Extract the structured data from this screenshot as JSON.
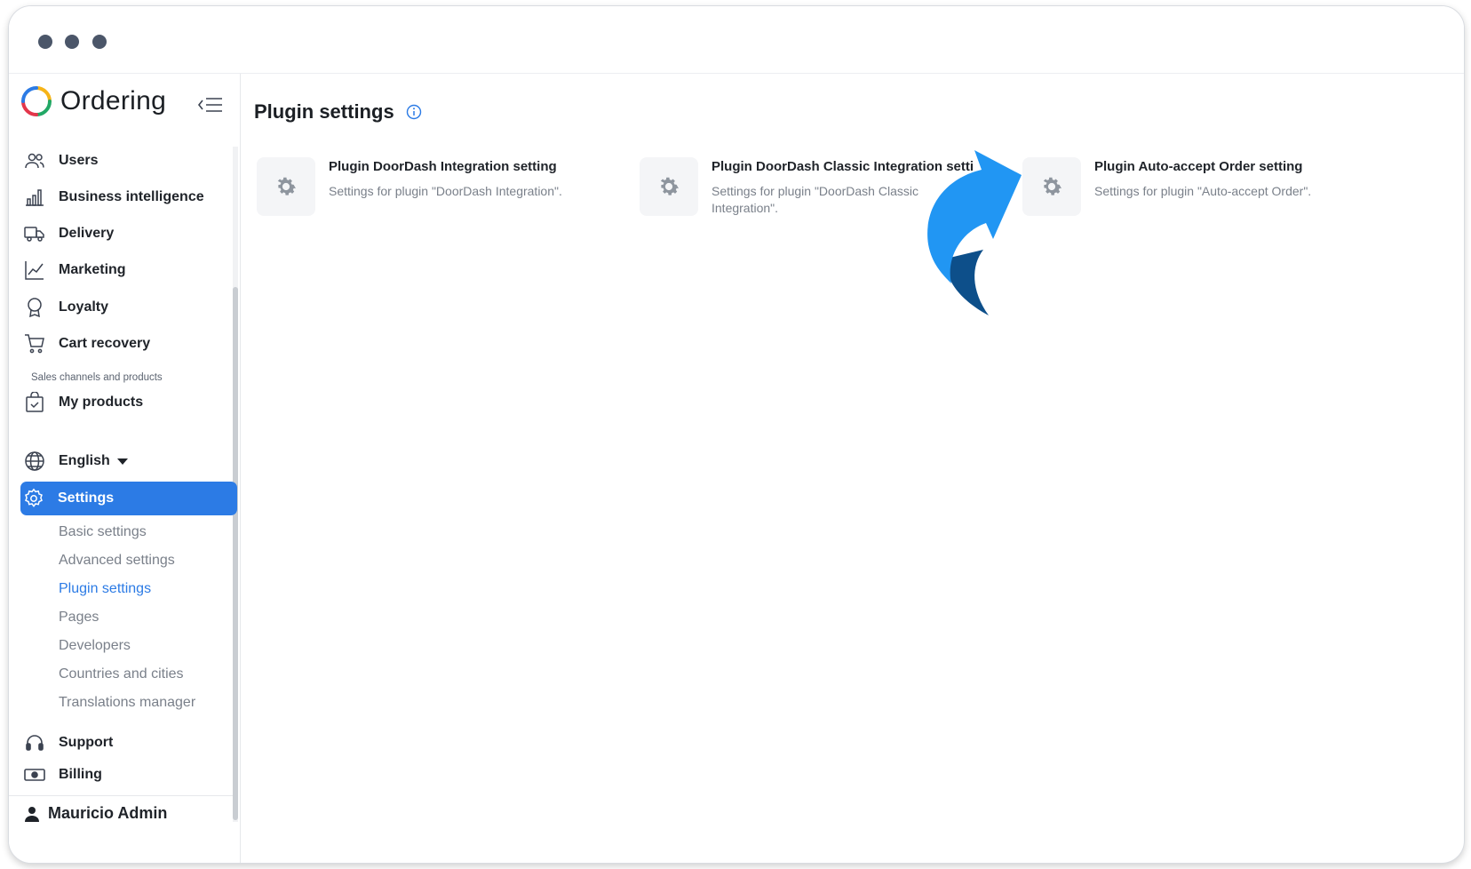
{
  "app": {
    "logo_text": "Ordering"
  },
  "sidebar": {
    "items": [
      {
        "label": "Users",
        "icon": "users-icon"
      },
      {
        "label": "Business intelligence",
        "icon": "bar-chart-icon"
      },
      {
        "label": "Delivery",
        "icon": "truck-icon"
      },
      {
        "label": "Marketing",
        "icon": "line-chart-icon"
      },
      {
        "label": "Loyalty",
        "icon": "award-icon"
      },
      {
        "label": "Cart recovery",
        "icon": "cart-icon"
      }
    ],
    "section_label": "Sales channels and products",
    "products_label": "My products",
    "language_label": "English",
    "settings_label": "Settings",
    "settings_sub": [
      "Basic settings",
      "Advanced settings",
      "Plugin settings",
      "Pages",
      "Developers",
      "Countries and cities",
      "Translations manager"
    ],
    "support_label": "Support",
    "billing_label": "Billing",
    "user_name": "Mauricio Admin"
  },
  "main": {
    "title": "Plugin settings",
    "cards": [
      {
        "title": "Plugin DoorDash Integration setting",
        "description": "Settings for plugin \"DoorDash Integration\"."
      },
      {
        "title": "Plugin DoorDash Classic Integration setti",
        "description": "Settings for plugin \"DoorDash Classic Integration\"."
      },
      {
        "title": "Plugin Auto-accept Order setting",
        "description": "Settings for plugin \"Auto-accept Order\"."
      }
    ]
  },
  "colors": {
    "accent": "#2c7be5",
    "arrow": "#2196f3",
    "arrow_shadow": "#0d4f8a"
  }
}
